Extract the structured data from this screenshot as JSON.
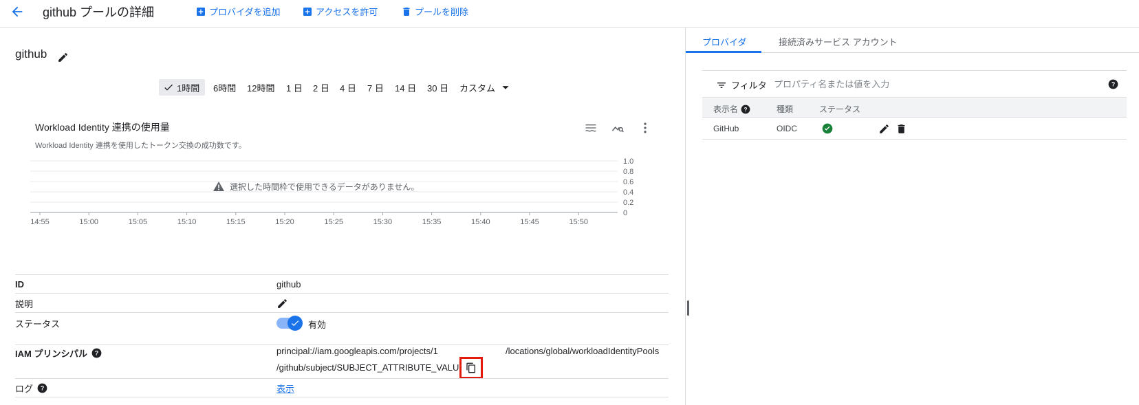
{
  "header": {
    "title": "github プールの詳細",
    "actions": {
      "add_provider": "プロバイダを追加",
      "grant_access": "アクセスを許可",
      "delete_pool": "プールを削除"
    }
  },
  "pool": {
    "name": "github"
  },
  "time_ranges": {
    "selected": "1時間",
    "r6h": "6時間",
    "r12h": "12時間",
    "r1d": "1 日",
    "r2d": "2 日",
    "r4d": "4 日",
    "r7d": "7 日",
    "r14d": "14 日",
    "r30d": "30 日",
    "custom": "カスタム"
  },
  "chart": {
    "title": "Workload Identity 連携の使用量",
    "subtitle": "Workload Identity 連携を使用したトークン交換の成功数です。",
    "empty_message": "選択した時間枠で使用できるデータがありません。"
  },
  "chart_data": {
    "type": "line",
    "title": "Workload Identity 連携の使用量",
    "x_ticks": [
      "14:55",
      "15:00",
      "15:05",
      "15:10",
      "15:15",
      "15:20",
      "15:25",
      "15:30",
      "15:35",
      "15:40",
      "15:45",
      "15:50"
    ],
    "y_ticks": [
      "0",
      "0.2",
      "0.4",
      "0.6",
      "0.8",
      "1.0"
    ],
    "ylim": [
      0,
      1.0
    ],
    "series": [],
    "grid": true,
    "y_axis_side": "right"
  },
  "details": {
    "id_label": "ID",
    "id_value": "github",
    "desc_label": "説明",
    "status_label": "ステータス",
    "status_value": "有効",
    "principal_label": "IAM プリンシパル",
    "principal_part1": "principal://iam.googleapis.com/projects/1",
    "principal_part2": "/locations/global/workloadIdentityPools",
    "principal_line2": "/github/subject/SUBJECT_ATTRIBUTE_VALUE",
    "log_label": "ログ",
    "log_link": "表示"
  },
  "right_panel": {
    "tabs": {
      "providers": "プロバイダ",
      "service_accounts": "接続済みサービス アカウント"
    },
    "filter_label": "フィルタ",
    "filter_placeholder": "プロパティ名または値を入力",
    "columns": {
      "display_name": "表示名",
      "type": "種類",
      "status": "ステータス"
    },
    "rows": [
      {
        "display_name": "GitHub",
        "type": "OIDC"
      }
    ]
  },
  "colors": {
    "accent": "#1a73e8",
    "success": "#188038",
    "highlight": "#e31b0c"
  }
}
